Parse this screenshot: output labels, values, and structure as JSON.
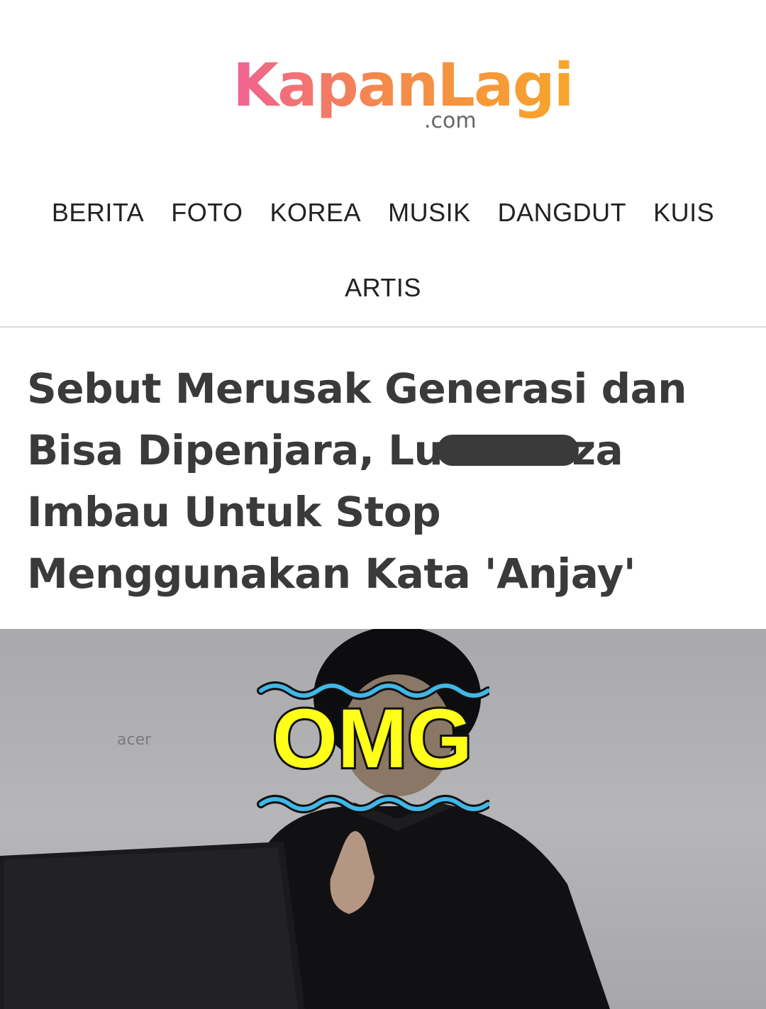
{
  "brand": {
    "name": "KapanLagi",
    "domain": ".com",
    "gradient_colors": [
      "#f06292",
      "#f48a4a",
      "#f7a62a"
    ]
  },
  "nav": {
    "items": [
      "BERITA",
      "FOTO",
      "KOREA",
      "MUSIK",
      "DANGDUT",
      "KUIS"
    ],
    "second_row_item": "ARTIS"
  },
  "article": {
    "headline_lines": [
      "Sebut Merusak Generasi dan",
      "Bisa Dipenjara, Lu",
      "Imbau Untuk Stop",
      "Menggunakan Kata 'Anjay'"
    ],
    "headline_line2_suffix": "za",
    "headline_color": "#3a3a3a"
  },
  "photo": {
    "overlay_text": "OMG",
    "overlay_color": "#ffff1a",
    "wave_color": "#3fb8e8",
    "laptop_brand": "acer"
  }
}
